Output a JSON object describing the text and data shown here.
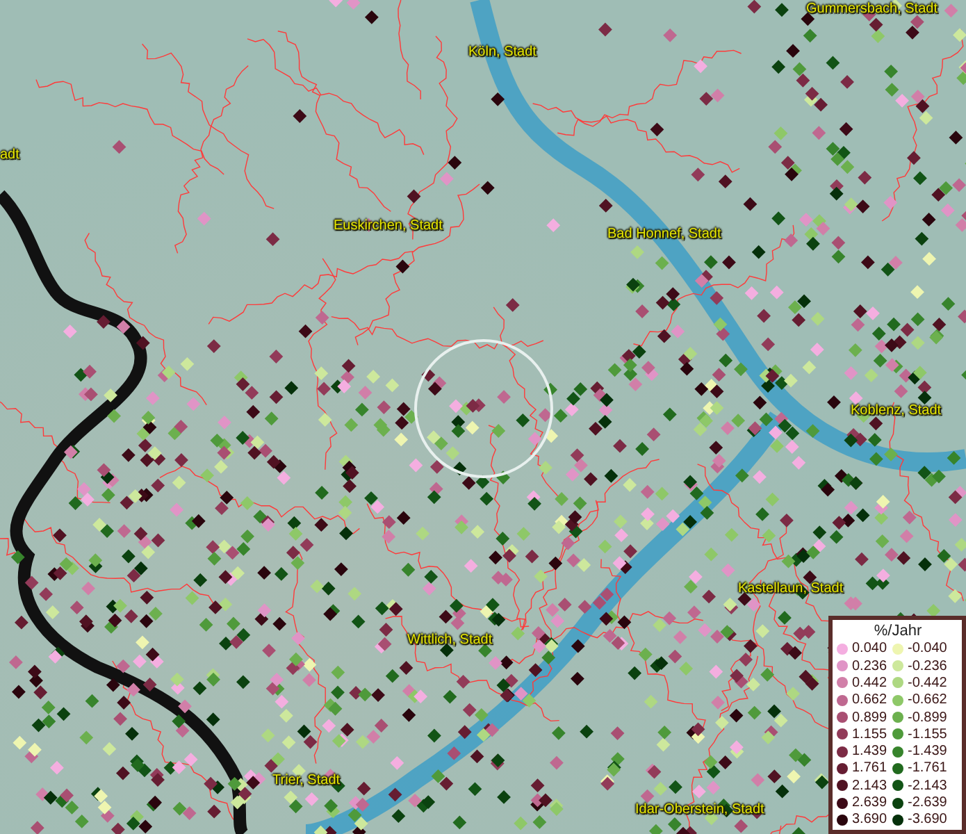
{
  "map": {
    "places": [
      {
        "name": "Gummersbach, Stadt",
        "kind": "city"
      },
      {
        "name": "adt",
        "kind": "city"
      },
      {
        "name": "Köln, Stadt",
        "kind": "city"
      },
      {
        "name": "Euskirchen, Stadt",
        "kind": "city"
      },
      {
        "name": "Bad Honnef, Stadt",
        "kind": "city"
      },
      {
        "name": "Koblenz, Stadt",
        "kind": "city"
      },
      {
        "name": "Kastellaun, Stadt",
        "kind": "city"
      },
      {
        "name": "Wittlich, Stadt",
        "kind": "city"
      },
      {
        "name": "Trier, Stadt",
        "kind": "city"
      },
      {
        "name": "Idar-Oberstein, Stadt",
        "kind": "city"
      }
    ]
  },
  "legend": {
    "title": "%/Jahr",
    "rows": [
      {
        "positive": {
          "label": "0.040",
          "color": "#f4aee0"
        },
        "negative": {
          "label": "-0.040",
          "color": "#eef5b0"
        }
      },
      {
        "positive": {
          "label": "0.236",
          "color": "#e094c6"
        },
        "negative": {
          "label": "-0.236",
          "color": "#cde89c"
        }
      },
      {
        "positive": {
          "label": "0.442",
          "color": "#d17fa8"
        },
        "negative": {
          "label": "-0.442",
          "color": "#aed882"
        }
      },
      {
        "positive": {
          "label": "0.662",
          "color": "#bf6890"
        },
        "negative": {
          "label": "-0.662",
          "color": "#8ec868"
        }
      },
      {
        "positive": {
          "label": "0.899",
          "color": "#a94f72"
        },
        "negative": {
          "label": "-0.899",
          "color": "#6cb04e"
        }
      },
      {
        "positive": {
          "label": "1.155",
          "color": "#923b59"
        },
        "negative": {
          "label": "-1.155",
          "color": "#4f9a3b"
        }
      },
      {
        "positive": {
          "label": "1.439",
          "color": "#7c2b45"
        },
        "negative": {
          "label": "-1.439",
          "color": "#37842c"
        }
      },
      {
        "positive": {
          "label": "1.761",
          "color": "#661d32"
        },
        "negative": {
          "label": "-1.761",
          "color": "#216a1e"
        }
      },
      {
        "positive": {
          "label": "2.143",
          "color": "#501222"
        },
        "negative": {
          "label": "-2.143",
          "color": "#125416"
        }
      },
      {
        "positive": {
          "label": "2.639",
          "color": "#3d0a17"
        },
        "negative": {
          "label": "-2.639",
          "color": "#0b420f"
        }
      },
      {
        "positive": {
          "label": "3.690",
          "color": "#2a050d"
        },
        "negative": {
          "label": "-3.690",
          "color": "#05300a"
        }
      }
    ]
  }
}
